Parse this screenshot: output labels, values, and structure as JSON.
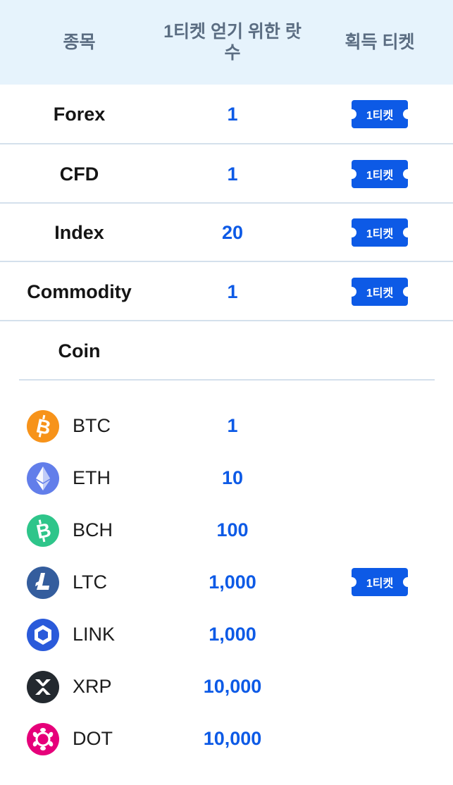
{
  "header": {
    "col_item": "종목",
    "col_lots": "1티켓 얻기 위한 랏수",
    "col_ticket": "획득 티켓"
  },
  "rows": [
    {
      "name": "Forex",
      "lots": "1",
      "ticket": "1티켓"
    },
    {
      "name": "CFD",
      "lots": "1",
      "ticket": "1티켓"
    },
    {
      "name": "Index",
      "lots": "20",
      "ticket": "1티켓"
    },
    {
      "name": "Commodity",
      "lots": "1",
      "ticket": "1티켓"
    },
    {
      "name": "Coin"
    }
  ],
  "coins": [
    {
      "symbol": "BTC",
      "lots": "1",
      "icon": "bitcoin-icon",
      "color": "#f7931a"
    },
    {
      "symbol": "ETH",
      "lots": "10",
      "icon": "ethereum-icon",
      "color": "#627eea"
    },
    {
      "symbol": "BCH",
      "lots": "100",
      "icon": "bitcoin-cash-icon",
      "color": "#2ec58a"
    },
    {
      "symbol": "LTC",
      "lots": "1,000",
      "icon": "litecoin-icon",
      "color": "#345d9d",
      "ticket": "1티켓"
    },
    {
      "symbol": "LINK",
      "lots": "1,000",
      "icon": "chainlink-icon",
      "color": "#2a5ada"
    },
    {
      "symbol": "XRP",
      "lots": "10,000",
      "icon": "xrp-icon",
      "color": "#23292f"
    },
    {
      "symbol": "DOT",
      "lots": "10,000",
      "icon": "polkadot-icon",
      "color": "#e6007a"
    }
  ],
  "colors": {
    "header_bg": "#e6f3fc",
    "header_text": "#5b6d82",
    "accent": "#0d5ae6",
    "divider": "#d4e0ec"
  }
}
